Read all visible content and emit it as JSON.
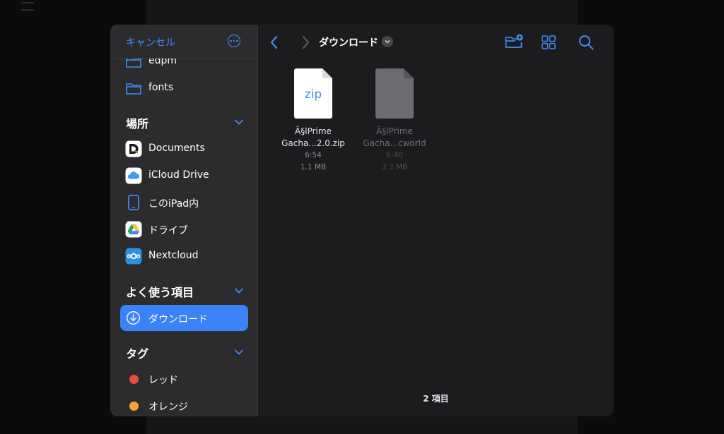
{
  "sidebar": {
    "cancel_label": "キャンセル",
    "more_icon": "ellipsis-circle-icon",
    "folders": [
      {
        "label": "edpm",
        "icon": "folder-icon"
      },
      {
        "label": "fonts",
        "icon": "folder-icon"
      }
    ],
    "locations_header": "場所",
    "locations": [
      {
        "label": "Documents",
        "icon": "documents-app-icon"
      },
      {
        "label": "iCloud Drive",
        "icon": "icloud-icon"
      },
      {
        "label": "このiPad内",
        "icon": "ipad-icon"
      },
      {
        "label": "ドライブ",
        "icon": "google-drive-icon"
      },
      {
        "label": "Nextcloud",
        "icon": "nextcloud-icon"
      }
    ],
    "favorites_header": "よく使う項目",
    "favorites": [
      {
        "label": "ダウンロード",
        "icon": "download-circle-icon",
        "selected": true
      }
    ],
    "tags_header": "タグ",
    "tags": [
      {
        "label": "レッド",
        "color": "#eb4d3d"
      },
      {
        "label": "オレンジ",
        "color": "#f2a33a"
      }
    ]
  },
  "toolbar": {
    "title": "ダウンロード",
    "accent": "#3d8ef7"
  },
  "files": [
    {
      "name_line1": "Â§lPrime",
      "name_line2": "Gacha...2.0.zip",
      "time": "6:54",
      "size": "1.1 MB",
      "type_label": "zip",
      "dimmed": false
    },
    {
      "name_line1": "Â§lPrime",
      "name_line2": "Gacha...cworld",
      "time": "6:40",
      "size": "3.3 MB",
      "type_label": "",
      "dimmed": true
    }
  ],
  "status": {
    "item_count": "2 項目"
  }
}
